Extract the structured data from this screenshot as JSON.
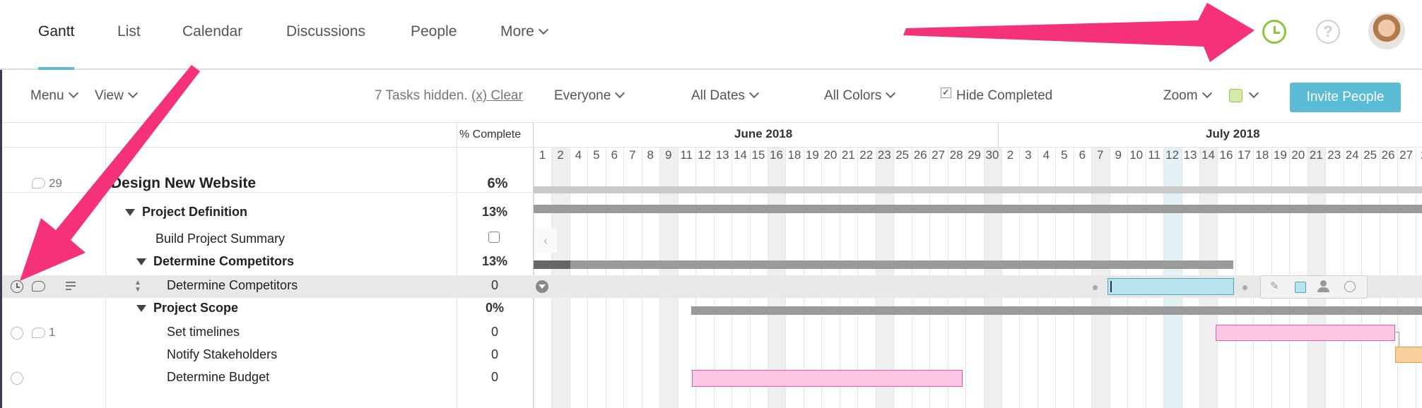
{
  "nav": {
    "tabs": [
      "Gantt",
      "List",
      "Calendar",
      "Discussions",
      "People",
      "More"
    ]
  },
  "toolbar": {
    "menu": "Menu",
    "view": "View",
    "hidden_text": "7 Tasks hidden.",
    "clear": "(x) Clear",
    "everyone": "Everyone",
    "all_dates": "All Dates",
    "all_colors": "All Colors",
    "hide_completed": "Hide Completed",
    "zoom": "Zoom",
    "invite": "Invite People"
  },
  "grid_header": {
    "pct_complete": "% Complete",
    "month1": "June 2018",
    "month2": "July 2018"
  },
  "days": [
    "1",
    "2",
    "4",
    "5",
    "6",
    "7",
    "8",
    "9",
    "11",
    "12",
    "13",
    "14",
    "15",
    "16",
    "18",
    "19",
    "20",
    "21",
    "22",
    "23",
    "25",
    "26",
    "27",
    "28",
    "29",
    "30",
    "2",
    "3",
    "4",
    "5",
    "6",
    "7",
    "9",
    "10",
    "11",
    "12",
    "13",
    "14",
    "16",
    "17",
    "18",
    "19",
    "20",
    "21",
    "23",
    "24",
    "25",
    "26",
    "27",
    "2"
  ],
  "rows": [
    {
      "name": "Design New Website",
      "pct": "6%",
      "comments": "29"
    },
    {
      "name": "Project Definition",
      "pct": "13%"
    },
    {
      "name": "Build Project Summary",
      "pct": ""
    },
    {
      "name": "Determine Competitors",
      "pct": "13%"
    },
    {
      "name": "Determine Competitors",
      "pct": "0"
    },
    {
      "name": "Project Scope",
      "pct": "0%"
    },
    {
      "name": "Set timelines",
      "pct": "0",
      "comments": "1"
    },
    {
      "name": "Notify Stakeholders",
      "pct": "0"
    },
    {
      "name": "Determine Budget",
      "pct": "0"
    }
  ],
  "colors": {
    "accent": "#5bbcd6",
    "arrow": "#f5317a",
    "clock_icon": "#8cc63f",
    "pink_bar": "#ffc6e6",
    "blue_bar": "#b8e3ee",
    "orange_bar": "#f8cf9c"
  },
  "icons": [
    "clock-icon",
    "help-icon",
    "avatar",
    "comment-icon",
    "checklist-icon",
    "drag-handle-icon",
    "pencil-icon",
    "color-icon",
    "person-icon",
    "time-icon"
  ]
}
